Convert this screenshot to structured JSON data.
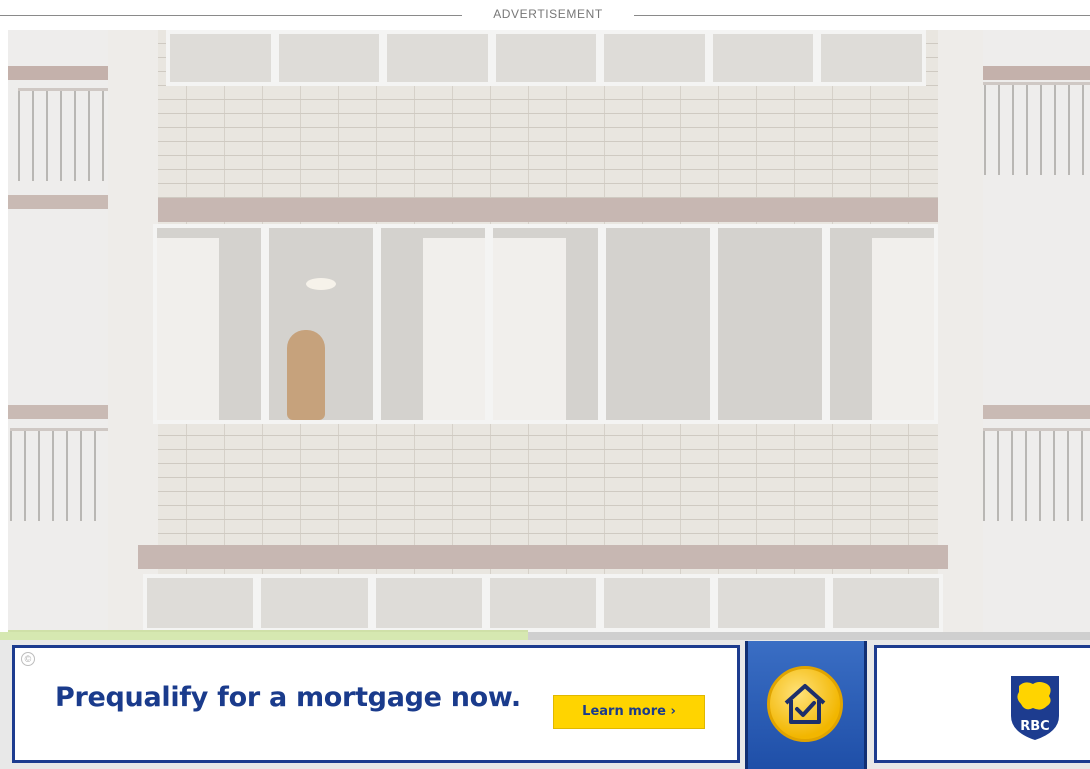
{
  "ad_label": "ADVERTISEMENT",
  "banner": {
    "headline": "Prequalify for a mortgage now.",
    "cta_label": "Learn more ›",
    "brand_text": "RBC",
    "adchoice_glyph": "©",
    "colors": {
      "brand_blue": "#1d3c8f",
      "cta_yellow": "#ffd400",
      "badge_gold": "#f2b600"
    },
    "icons": [
      "house-check-icon",
      "rbc-lion-shield-logo"
    ]
  }
}
